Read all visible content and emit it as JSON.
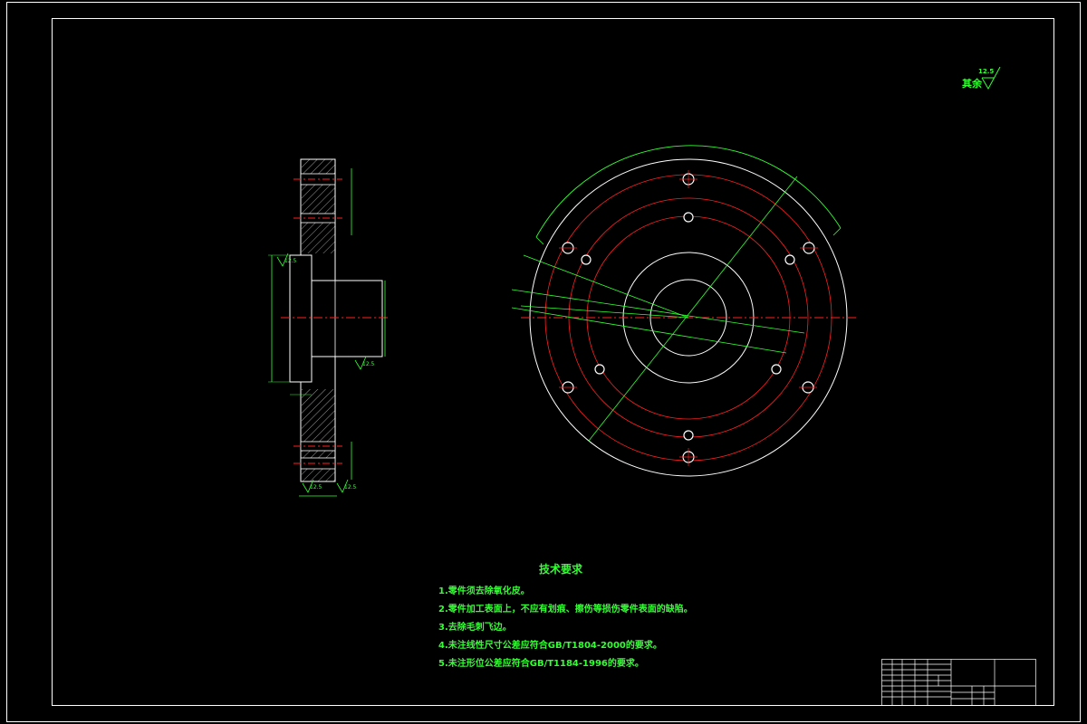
{
  "colors": {
    "background": "#000000",
    "frame": "#ffffff",
    "dimension": "#33ff33",
    "center_line": "#ff2020",
    "outline": "#ffffff"
  },
  "drawing": {
    "roughness_note": {
      "label": "其余",
      "value": "12.5"
    },
    "tech_requirements": {
      "title": "技术要求",
      "items": [
        "1.零件须去除氧化皮。",
        "2.零件加工表面上，不应有划痕、擦伤等损伤零件表面的缺陷。",
        "3.去除毛刺飞边。",
        "4.未注线性尺寸公差应符合GB/T1804-2000的要求。",
        "5.未注形位公差应符合GB/T1184-1996的要求。"
      ]
    },
    "section_view": {
      "roughness_marks": [
        "12.5",
        "12.5",
        "12.5",
        "12.5"
      ]
    }
  }
}
